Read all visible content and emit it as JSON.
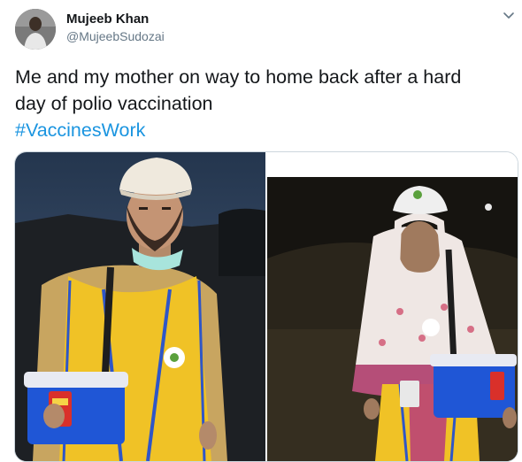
{
  "tweet": {
    "author_name": "Mujeeb Khan",
    "author_handle": "@MujeebSudozai",
    "text_line1": "Me and my mother on way to home back after a hard",
    "text_line2": "day of polio  vaccination",
    "hashtag": "#VaccinesWork"
  },
  "icons": {
    "more": "chevron-down-icon"
  },
  "media": {
    "photos": [
      {
        "description_icon": "photo-son-icon"
      },
      {
        "description_icon": "photo-mother-icon"
      }
    ]
  },
  "colors": {
    "text": "#14171a",
    "secondary": "#657786",
    "link": "#1b95e0",
    "border": "#ccd6dd"
  }
}
